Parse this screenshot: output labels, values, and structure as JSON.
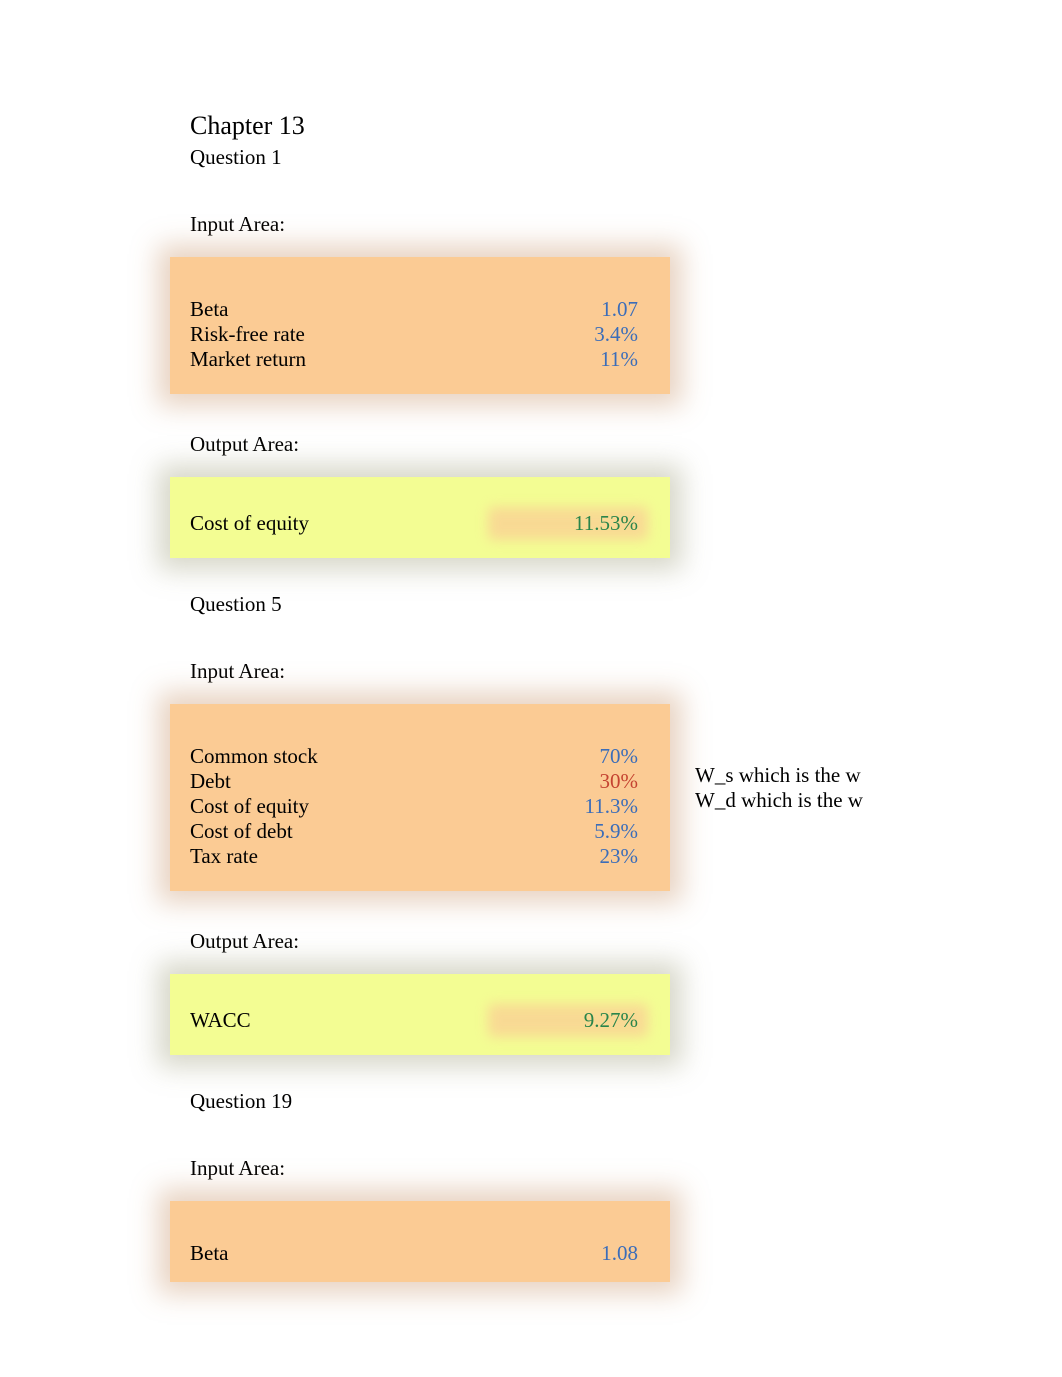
{
  "chapter": "Chapter 13",
  "q1": {
    "title": "Question 1",
    "input_label": "Input Area:",
    "output_label": "Output Area:",
    "inputs": {
      "beta_label": "Beta",
      "beta_value": "1.07",
      "rf_label": "Risk-free rate",
      "rf_value": "3.4%",
      "mr_label": "Market return",
      "mr_value": "11%"
    },
    "outputs": {
      "coe_label": "Cost of equity",
      "coe_value": "11.53%"
    }
  },
  "q5": {
    "title": "Question 5",
    "input_label": "Input Area:",
    "output_label": "Output Area:",
    "inputs": {
      "cs_label": "Common stock",
      "cs_value": "70%",
      "debt_label": "Debt",
      "debt_value": "30%",
      "coe_label": "Cost of equity",
      "coe_value": "11.3%",
      "cod_label": "Cost of debt",
      "cod_value": "5.9%",
      "tax_label": "Tax rate",
      "tax_value": "23%"
    },
    "notes": {
      "ws": "W_s which is the w",
      "wd": "W_d which is the w"
    },
    "outputs": {
      "wacc_label": "WACC",
      "wacc_value": "9.27%"
    }
  },
  "q19": {
    "title": "Question 19",
    "input_label": "Input Area:",
    "inputs": {
      "beta_label": "Beta",
      "beta_value": "1.08"
    }
  }
}
